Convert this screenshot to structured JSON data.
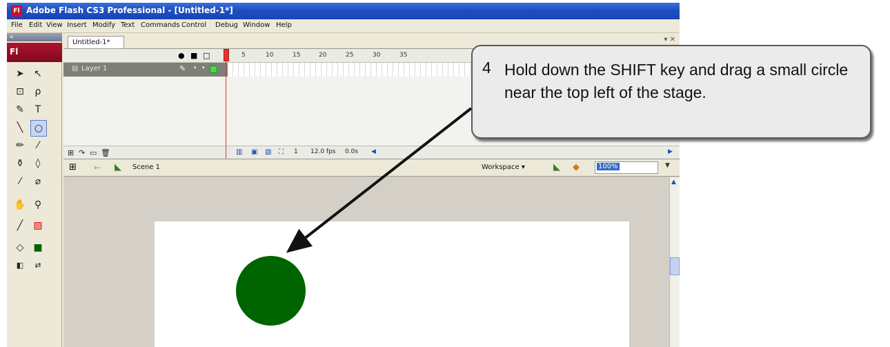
{
  "window": {
    "app_badge": "Fl",
    "title": "Adobe Flash CS3 Professional - [Untitled-1*]"
  },
  "menu": [
    "File",
    "Edit",
    "View",
    "Insert",
    "Modify",
    "Text",
    "Commands",
    "Control",
    "Debug",
    "Window",
    "Help"
  ],
  "tools": {
    "panel_header": "«",
    "badge": "Fl"
  },
  "document": {
    "tab_label": "Untitled-1*",
    "panel_controls": "▾ ✕"
  },
  "timeline": {
    "frame_numbers": [
      "5",
      "10",
      "15",
      "20",
      "25",
      "30",
      "35"
    ],
    "layer_name": "Layer 1",
    "current_frame": "1",
    "frame_rate": "12.0 fps",
    "elapsed_time": "0.0s"
  },
  "edit_bar": {
    "scene_label": "Scene 1",
    "workspace_label": "Workspace ▾",
    "zoom": "100%"
  },
  "stage": {
    "circle_color": "#006400",
    "background": "#ffffff"
  },
  "callout": {
    "number": "4",
    "text": "Hold down the SHIFT key and drag a small circle near the top left of the stage."
  }
}
